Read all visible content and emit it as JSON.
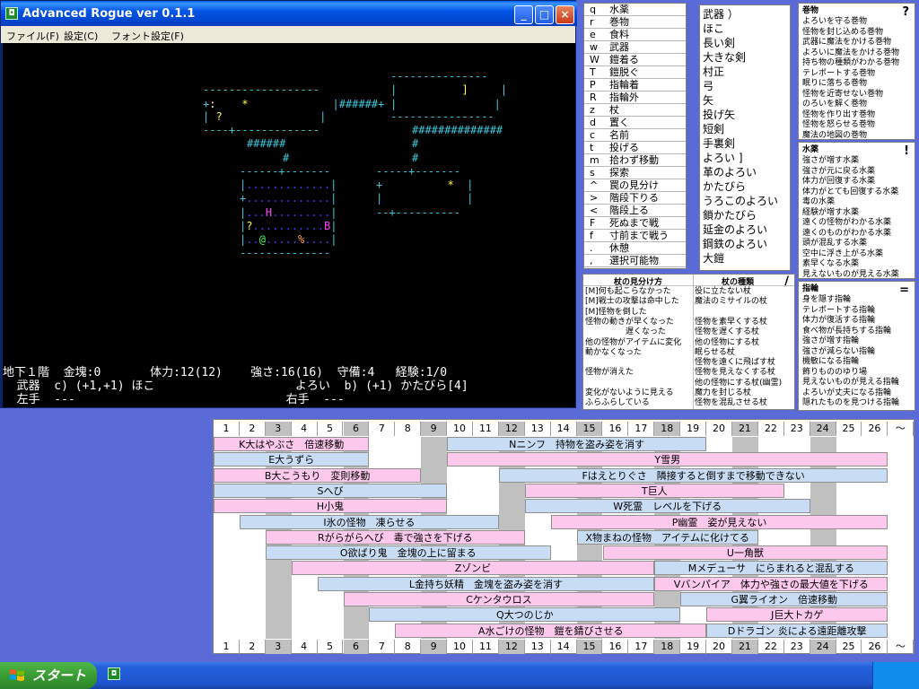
{
  "window": {
    "title": "Advanced Rogue ver 0.1.1",
    "app_icon": "rogue-app-icon",
    "buttons": {
      "minimize": "_",
      "maximize": "□",
      "close": "×"
    },
    "menus": [
      "ファイル(F)",
      "設定(C)",
      "フォント設定(F)"
    ]
  },
  "game": {
    "map_rows": [
      {
        "text": "------------------",
        "cls": "cy"
      },
      {
        "text": "+:    *            |######+",
        "cls": "cy"
      },
      {
        "text": "| ?                |",
        "cls": "cy"
      }
    ],
    "status_line1": "地下１階  金塊:0       体力:12(12)    強さ:16(16)  守備:4   経験:1/0",
    "status_line2": "  武器  c) (+1,+1) ほこ                    よろい  b) (+1) かたびら[4]",
    "status_line3": "  左手  ---                              右手  ---"
  },
  "commands": [
    {
      "key": "q",
      "label": "水薬"
    },
    {
      "key": "r",
      "label": "巻物"
    },
    {
      "key": "e",
      "label": "食料"
    },
    {
      "key": "w",
      "label": "武器"
    },
    {
      "key": "W",
      "label": "鎧着る"
    },
    {
      "key": "T",
      "label": "鎧脱ぐ"
    },
    {
      "key": "P",
      "label": "指輪着"
    },
    {
      "key": "R",
      "label": "指輪外"
    },
    {
      "key": "z",
      "label": "杖"
    },
    {
      "key": "d",
      "label": "置く"
    },
    {
      "key": "c",
      "label": "名前"
    },
    {
      "key": "t",
      "label": "投げる"
    },
    {
      "key": "m",
      "label": "拾わず移動"
    },
    {
      "key": "s",
      "label": "探索"
    },
    {
      "key": "^",
      "label": "罠の見分け"
    },
    {
      "key": ">",
      "label": "階段下りる"
    },
    {
      "key": "<",
      "label": "階段上る"
    },
    {
      "key": "F",
      "label": "死ぬまで戦"
    },
    {
      "key": "f",
      "label": "寸前まで戦う"
    },
    {
      "key": ".",
      "label": "休憩"
    },
    {
      "key": ",",
      "label": "選択可能物"
    }
  ],
  "weapons": {
    "header": "武器 ）",
    "items": [
      "ほこ",
      "長い剣",
      "大きな剣",
      "村正",
      "弓",
      "矢",
      "投げ矢",
      "短剣",
      "手裏剣"
    ],
    "armor_header": "よろい ]",
    "armor": [
      "革のよろい",
      "かたびら",
      "うろこのよろい",
      "鎖かたびら",
      "延金のよろい",
      "鋼鉄のよろい",
      "大鎧"
    ]
  },
  "scrolls": {
    "title": "巻物",
    "mark": "?",
    "items": [
      "よろいを守る巻物",
      "怪物を封じ込める巻物",
      "武器に魔法をかける巻物",
      "よろいに魔法をかける巻物",
      "持ち物の種類がわかる巻物",
      "テレポートする巻物",
      "眠りに落ちる巻物",
      "怪物を近寄せない巻物",
      "のろいを解く巻物",
      "怪物を作り出す巻物",
      "怪物を怒らせる巻物",
      "魔法の地図の巻物"
    ]
  },
  "potions": {
    "title": "水薬",
    "mark": "!",
    "items": [
      "強さが増す水薬",
      "強さが元に戻る水薬",
      "体力が回復する水薬",
      "体力がとても回復する水薬",
      "毒の水薬",
      "経験が増す水薬",
      "遠くの怪物がわかる水薬",
      "遠くのものがわかる水薬",
      "頭が混乱する水薬",
      "空中に浮き上がる水薬",
      "素早くなる水薬",
      "見えないものが見える水薬"
    ]
  },
  "rings": {
    "title": "指輪",
    "mark": "=",
    "items": [
      "身を隠す指輪",
      "テレポートする指輪",
      "体力が復活する指輪",
      "食べ物が長持ちする指輪",
      "強さが増す指輪",
      "強さが減らない指輪",
      "機敏になる指輪",
      "飾りもののゆり場",
      "見えないものが見える指輪",
      "よろいが丈夫になる指輪",
      "隠れたものを見つける指輪"
    ]
  },
  "wands": {
    "col1_header": "杖の見分け方",
    "col2_header": "杖の種類",
    "mark": "/",
    "rows": [
      {
        "a": "[M]何も起こらなかった",
        "b": "役に立たない杖"
      },
      {
        "a": "[M]戦士の攻撃は命中した",
        "b": "魔法のミサイルの杖"
      },
      {
        "a": "[M]怪物を倒した",
        "b": ""
      },
      {
        "a": "怪物の動きが早くなった",
        "b": "怪物を素早くする杖"
      },
      {
        "a": "　　　　　遅くなった",
        "b": "怪物を遅くする杖"
      },
      {
        "a": "他の怪物がアイテムに変化",
        "b": "他の怪物にする杖"
      },
      {
        "a": "動かなくなった",
        "b": "眠らせる杖"
      },
      {
        "a": "",
        "b": "怪物を遠くに飛ばす杖"
      },
      {
        "a": "怪物が消えた",
        "b": "怪物を見えなくする杖"
      },
      {
        "a": "",
        "b": "他の怪物にする杖(幽霊)"
      },
      {
        "a": "変化がないように見える",
        "b": "魔力を封じる杖"
      },
      {
        "a": "ふらふらしている",
        "b": "怪物を混乱させる杖"
      }
    ]
  },
  "monster_table": {
    "levels": [
      "1",
      "2",
      "3",
      "4",
      "5",
      "6",
      "7",
      "8",
      "9",
      "10",
      "11",
      "12",
      "13",
      "14",
      "15",
      "16",
      "17",
      "18",
      "19",
      "20",
      "21",
      "22",
      "23",
      "24",
      "25",
      "26",
      "〜"
    ],
    "bars": [
      {
        "label": "K大はやぶさ　倍速移動",
        "s": 1,
        "e": 6,
        "c": "p",
        "r": 0
      },
      {
        "label": "Nニンフ　持物を盗み姿を消す",
        "s": 10,
        "e": 19,
        "c": "b",
        "r": 0
      },
      {
        "label": "E大うずら",
        "s": 1,
        "e": 6,
        "c": "b",
        "r": 1
      },
      {
        "label": "Y雪男",
        "s": 10,
        "e": 26,
        "c": "p",
        "r": 1
      },
      {
        "label": "B大こうもり　変則移動",
        "s": 1,
        "e": 8,
        "c": "p",
        "r": 2
      },
      {
        "label": "Fはえとりぐさ　隣接すると倒すまで移動できない",
        "s": 12,
        "e": 26,
        "c": "b",
        "r": 2
      },
      {
        "label": "Sへび",
        "s": 1,
        "e": 9,
        "c": "b",
        "r": 3
      },
      {
        "label": "T巨人",
        "s": 13,
        "e": 22,
        "c": "p",
        "r": 3
      },
      {
        "label": "H小鬼",
        "s": 1,
        "e": 9,
        "c": "p",
        "r": 4
      },
      {
        "label": "W死霊　レベルを下げる",
        "s": 13,
        "e": 23,
        "c": "b",
        "r": 4
      },
      {
        "label": "I氷の怪物　凍らせる",
        "s": 2,
        "e": 11,
        "c": "b",
        "r": 5
      },
      {
        "label": "P幽霊　姿が見えない",
        "s": 14,
        "e": 26,
        "c": "p",
        "r": 5
      },
      {
        "label": "Rがらがらへび　毒で強さを下げる",
        "s": 3,
        "e": 12,
        "c": "p",
        "r": 6
      },
      {
        "label": "X物まねの怪物　アイテムに化けてる",
        "s": 15,
        "e": 21,
        "c": "b",
        "r": 6
      },
      {
        "label": "O欲ばり鬼　金塊の上に留まる",
        "s": 3,
        "e": 13,
        "c": "b",
        "r": 7
      },
      {
        "label": "U一角獣",
        "s": 16,
        "e": 26,
        "c": "p",
        "r": 7
      },
      {
        "label": "Zゾンビ",
        "s": 4,
        "e": 17,
        "c": "p",
        "r": 8
      },
      {
        "label": "Mメデューサ　にらまれると混乱する",
        "s": 18,
        "e": 26,
        "c": "b",
        "r": 8
      },
      {
        "label": "L金持ち妖精　金塊を盗み姿を消す",
        "s": 5,
        "e": 17,
        "c": "b",
        "r": 9
      },
      {
        "label": "Vバンパイア　体力や強さの最大値を下げる",
        "s": 18,
        "e": 26,
        "c": "p",
        "r": 9
      },
      {
        "label": "Cケンタウロス",
        "s": 6,
        "e": 17,
        "c": "p",
        "r": 10
      },
      {
        "label": "G翼ライオン　倍速移動",
        "s": 19,
        "e": 26,
        "c": "b",
        "r": 10
      },
      {
        "label": "Q大つのじか",
        "s": 7,
        "e": 18,
        "c": "b",
        "r": 11
      },
      {
        "label": "J巨大トカゲ",
        "s": 20,
        "e": 26,
        "c": "p",
        "r": 11
      },
      {
        "label": "A水ごけの怪物　鎧を錆びさせる",
        "s": 8,
        "e": 19,
        "c": "p",
        "r": 12
      },
      {
        "label": "Dドラゴン 炎による遠距離攻撃",
        "s": 20,
        "e": 26,
        "c": "b",
        "r": 12
      }
    ]
  },
  "taskbar": {
    "start_label": "スタート",
    "start_icon": "windows-flag-icon",
    "task_icon": "rogue-app-icon"
  }
}
